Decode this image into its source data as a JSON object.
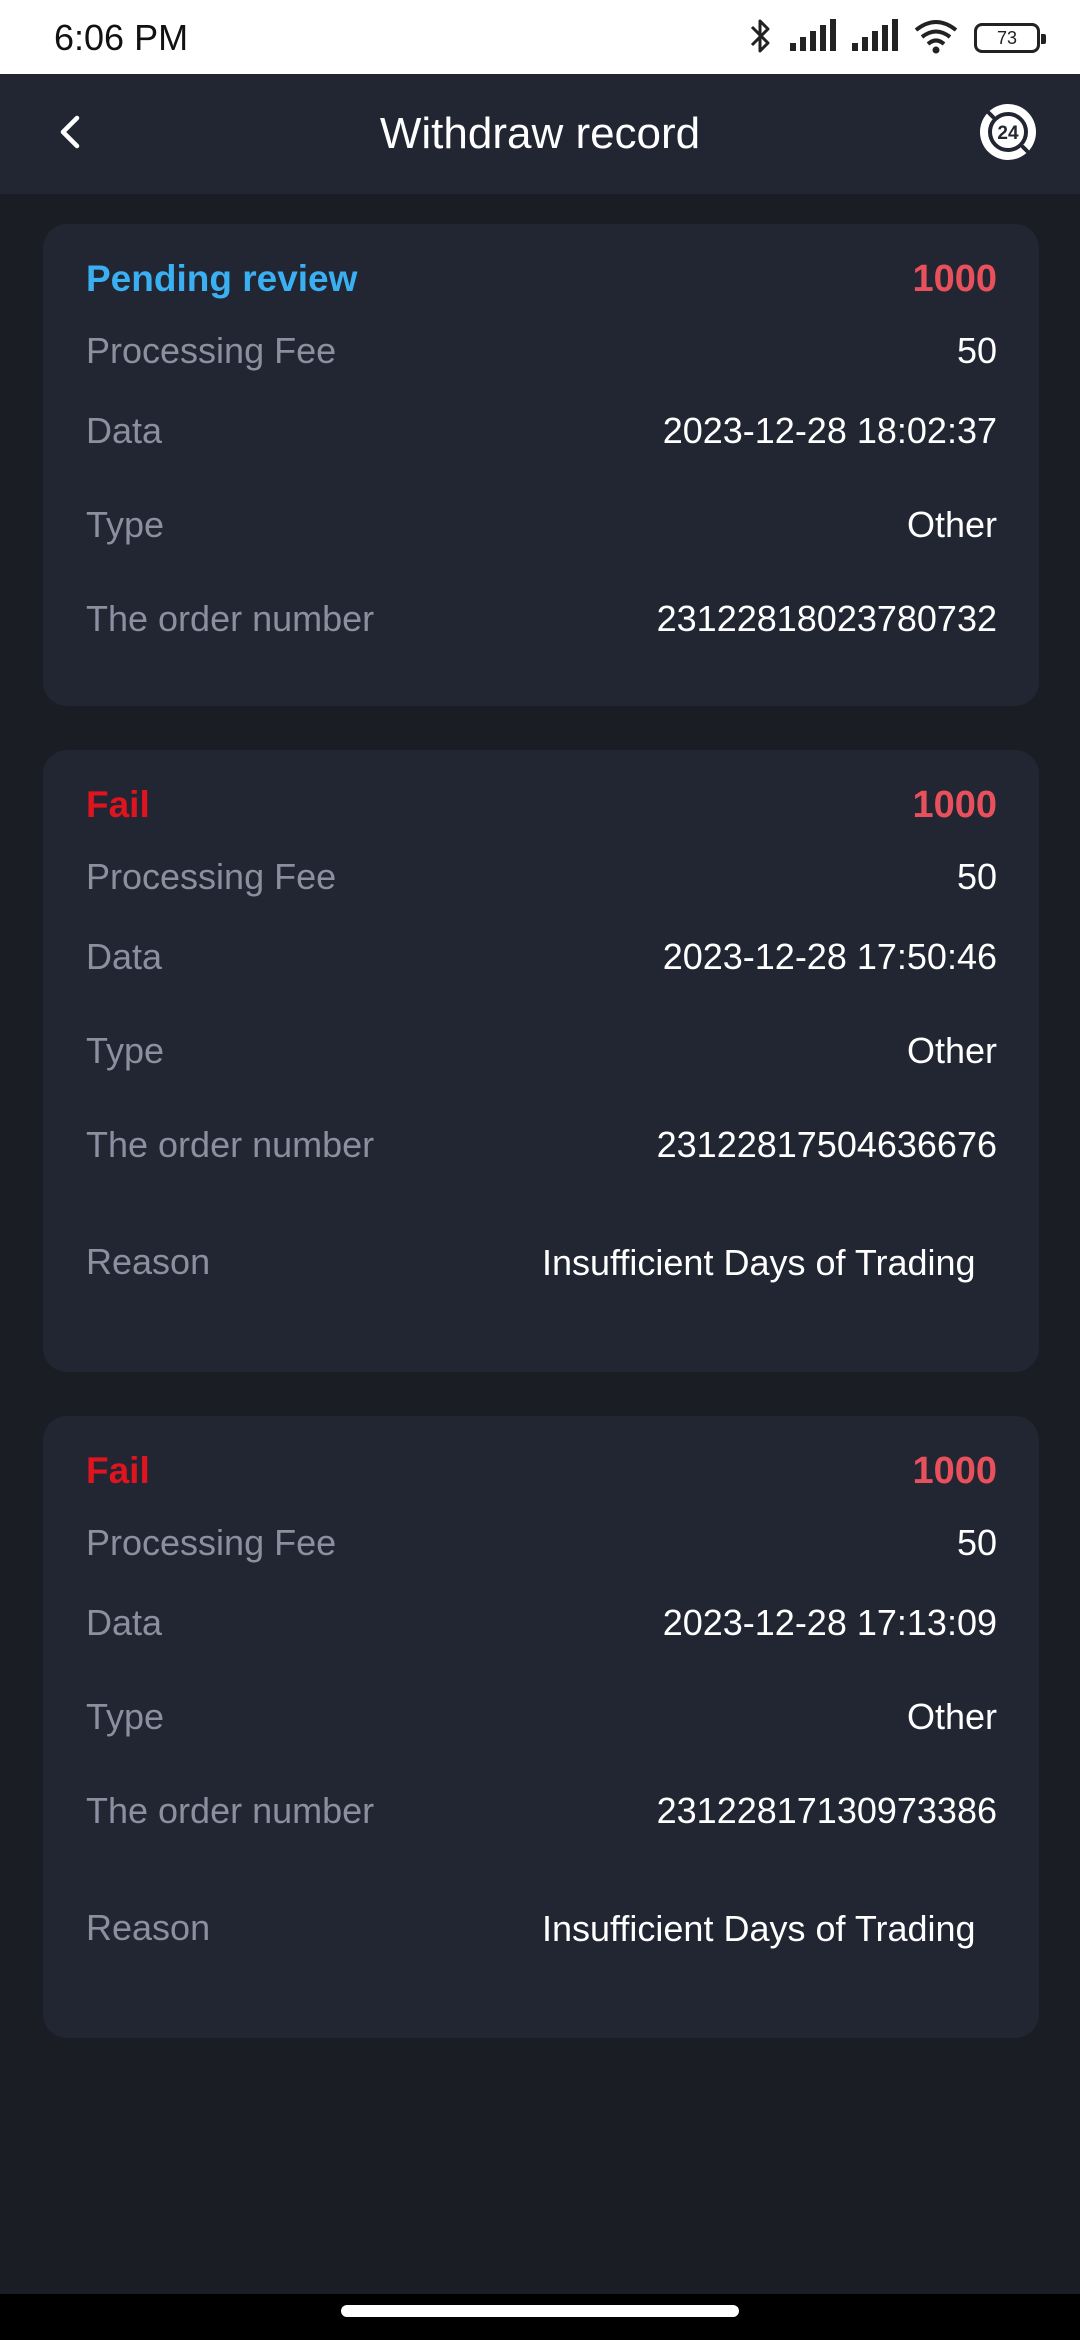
{
  "status_bar": {
    "time": "6:06 PM",
    "battery": "73"
  },
  "header": {
    "title": "Withdraw record"
  },
  "colors": {
    "pending": "#3ab0f3",
    "fail": "#e0141e",
    "amount": "#e8515c"
  },
  "records": [
    {
      "status": "Pending review",
      "amount": "1000",
      "fee_label": "Processing Fee",
      "fee": "50",
      "date_label": "Data",
      "date": "2023-12-28 18:02:37",
      "type_label": "Type",
      "type": "Other",
      "order_label": "The order number",
      "order": "23122818023780732"
    },
    {
      "status": "Fail",
      "amount": "1000",
      "fee_label": "Processing Fee",
      "fee": "50",
      "date_label": "Data",
      "date": "2023-12-28 17:50:46",
      "type_label": "Type",
      "type": "Other",
      "order_label": "The order number",
      "order": "23122817504636676",
      "reason_label": "Reason",
      "reason": "Insufficient Days of Trading"
    },
    {
      "status": "Fail",
      "amount": "1000",
      "fee_label": "Processing Fee",
      "fee": "50",
      "date_label": "Data",
      "date": "2023-12-28 17:13:09",
      "type_label": "Type",
      "type": "Other",
      "order_label": "The order number",
      "order": "23122817130973386",
      "reason_label": "Reason",
      "reason": "Insufficient Days of Trading"
    }
  ]
}
